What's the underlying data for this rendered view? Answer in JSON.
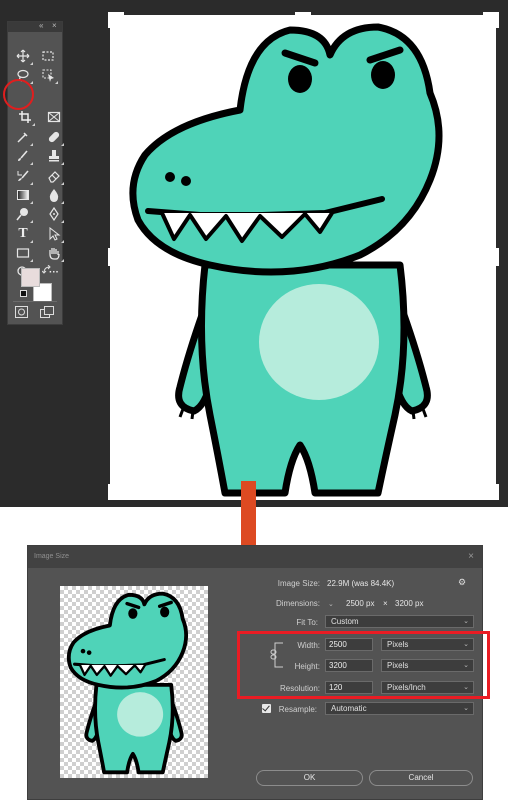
{
  "toolbar": {
    "tools": [
      {
        "name": "move-tool",
        "icon": "move-icon"
      },
      {
        "name": "marquee-tool",
        "icon": "marquee-icon"
      },
      {
        "name": "lasso-tool",
        "icon": "lasso-icon"
      },
      {
        "name": "object-select-tool",
        "icon": "object-select-icon"
      },
      {
        "name": "crop-tool",
        "icon": "crop-icon"
      },
      {
        "name": "frame-tool",
        "icon": "frame-icon"
      },
      {
        "name": "eyedropper-tool",
        "icon": "eyedropper-icon"
      },
      {
        "name": "healing-tool",
        "icon": "bandage-icon"
      },
      {
        "name": "brush-tool",
        "icon": "brush-icon"
      },
      {
        "name": "stamp-tool",
        "icon": "stamp-icon"
      },
      {
        "name": "history-brush-tool",
        "icon": "history-brush-icon"
      },
      {
        "name": "eraser-tool",
        "icon": "eraser-icon"
      },
      {
        "name": "gradient-tool",
        "icon": "gradient-icon"
      },
      {
        "name": "blur-tool",
        "icon": "drop-icon"
      },
      {
        "name": "dodge-tool",
        "icon": "dodge-icon"
      },
      {
        "name": "pen-tool",
        "icon": "pen-icon"
      },
      {
        "name": "type-tool",
        "icon": "type-icon"
      },
      {
        "name": "path-select-tool",
        "icon": "arrow-icon"
      },
      {
        "name": "rectangle-tool",
        "icon": "rectangle-icon"
      },
      {
        "name": "hand-tool",
        "icon": "hand-icon"
      },
      {
        "name": "zoom-tool",
        "icon": "zoom-icon"
      },
      {
        "name": "more-tools",
        "icon": "ellipsis-icon"
      }
    ],
    "type_glyph": "T",
    "more_glyph": "···",
    "collapse_glyph": "«",
    "close_glyph": "×",
    "foreground_color": "#e8dcdc",
    "background_color": "#ffffff"
  },
  "canvas": {
    "character_colors": {
      "body": "#4fd3b8",
      "belly": "#b6ecdc",
      "outline": "#000000"
    }
  },
  "dialog": {
    "title": "Image Size",
    "close_glyph": "×",
    "gear_glyph": "⚙",
    "image_size_label": "Image Size:",
    "image_size_value": "22.9M (was 84.4K)",
    "dimensions_label": "Dimensions:",
    "dimensions_width": "2500 px",
    "dimensions_times": "×",
    "dimensions_height": "3200 px",
    "fit_to_label": "Fit To:",
    "fit_to_value": "Custom",
    "width_label": "Width:",
    "width_value": "2500",
    "width_unit": "Pixels",
    "height_label": "Height:",
    "height_value": "3200",
    "height_unit": "Pixels",
    "resolution_label": "Resolution:",
    "resolution_value": "120",
    "resolution_unit": "Pixels/Inch",
    "resample_label": "Resample:",
    "resample_checked": true,
    "resample_value": "Automatic",
    "ok_label": "OK",
    "cancel_label": "Cancel",
    "chevron_glyph": "⌄"
  },
  "highlight_color": "#ea1c24",
  "arrow_color": "#dd4a22"
}
